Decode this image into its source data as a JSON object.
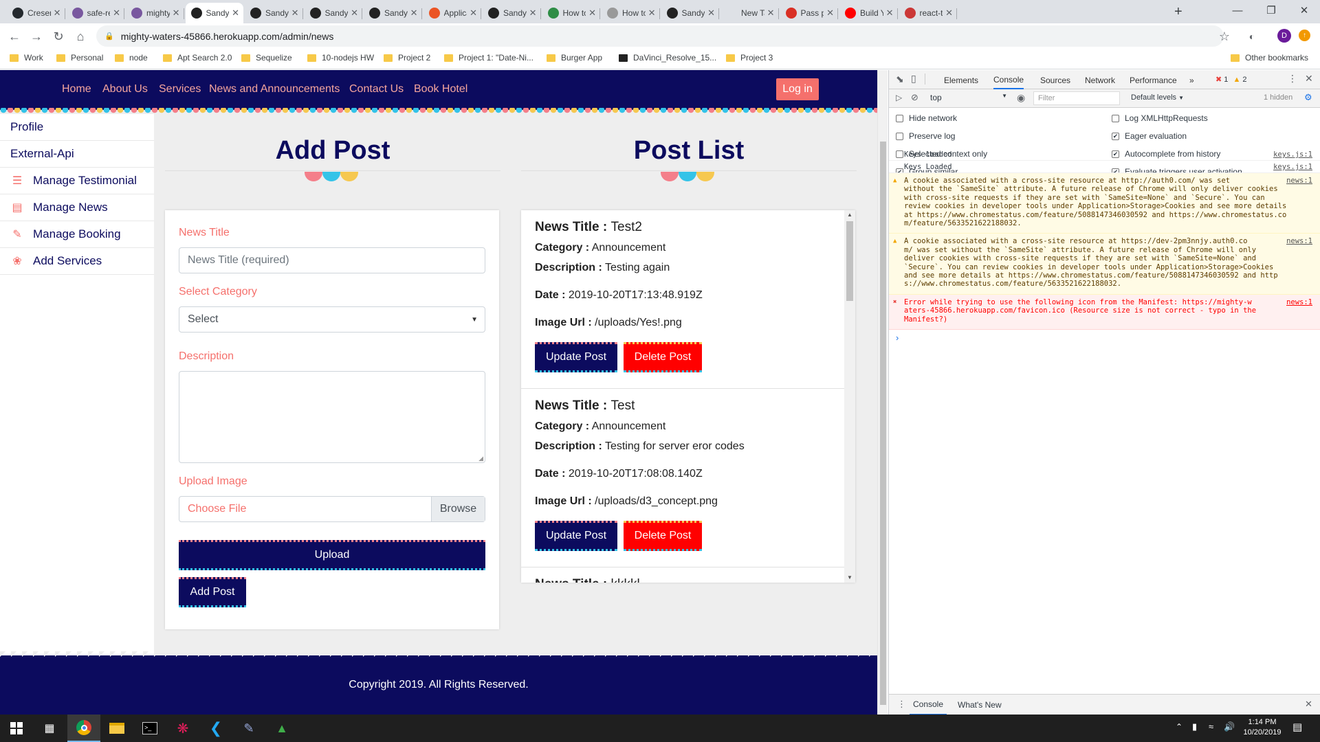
{
  "browser": {
    "tabs": [
      {
        "title": "Cresenc",
        "icon": "github-icon",
        "color": "#24292e"
      },
      {
        "title": "safe-ret",
        "icon": "heroku-icon",
        "color": "#79589f"
      },
      {
        "title": "mighty-",
        "icon": "heroku-icon",
        "color": "#79589f"
      },
      {
        "title": "Sandy's",
        "icon": "react-icon",
        "color": "#222"
      },
      {
        "title": "Sandy's",
        "icon": "react-icon",
        "color": "#222"
      },
      {
        "title": "Sandy's",
        "icon": "react-icon",
        "color": "#222"
      },
      {
        "title": "Sandy's",
        "icon": "react-icon",
        "color": "#222"
      },
      {
        "title": "Applica",
        "icon": "auth0-icon",
        "color": "#eb5424"
      },
      {
        "title": "Sandy's",
        "icon": "react-icon",
        "color": "#222"
      },
      {
        "title": "How to",
        "icon": "gfg-icon",
        "color": "#2f8d46"
      },
      {
        "title": "How to",
        "icon": "loading-icon",
        "color": "#999"
      },
      {
        "title": "Sandy's",
        "icon": "react-icon",
        "color": "#222"
      },
      {
        "title": "New Tab",
        "icon": "",
        "color": ""
      },
      {
        "title": "Pass pr",
        "icon": "chrome-red-icon",
        "color": "#d93025"
      },
      {
        "title": "Build Yo",
        "icon": "youtube-icon",
        "color": "#ff0000"
      },
      {
        "title": "react-to",
        "icon": "npm-icon",
        "color": "#cb3837"
      }
    ],
    "url": "mighty-waters-45866.herokuapp.com/admin/news",
    "bookmarks": [
      "Work",
      "Personal",
      "node",
      "Apt Search 2.0",
      "Sequelize",
      "10-nodejs HW",
      "Project 2",
      "Project 1: \"Date-Ni...",
      "Burger App",
      "DaVinci_Resolve_15...",
      "Project 3"
    ],
    "other_bookmarks": "Other bookmarks",
    "profile_initial": "D"
  },
  "site": {
    "nav": [
      "Home",
      "About Us",
      "Services",
      "News and Announcements",
      "Contact Us",
      "Book Hotel"
    ],
    "login": "Log in",
    "sidebar": [
      {
        "label": "Profile",
        "icon": ""
      },
      {
        "label": "External-Api",
        "icon": ""
      },
      {
        "label": "Manage Testimonial",
        "icon": "list-icon"
      },
      {
        "label": "Manage News",
        "icon": "newspaper-icon"
      },
      {
        "label": "Manage Booking",
        "icon": "pencil-icon"
      },
      {
        "label": "Add Services",
        "icon": "paw-icon"
      }
    ],
    "add_post": {
      "heading": "Add Post",
      "news_title_label": "News Title",
      "news_title_placeholder": "News Title (required)",
      "category_label": "Select Category",
      "category_value": "Select",
      "description_label": "Description",
      "upload_label": "Upload Image",
      "choose_file": "Choose File",
      "browse": "Browse",
      "upload_button": "Upload",
      "add_button": "Add Post"
    },
    "post_list": {
      "heading": "Post List",
      "posts": [
        {
          "title_label": "News Title :",
          "title": "Test2",
          "category_label": "Category :",
          "category": "Announcement",
          "description_label": "Description :",
          "description": "Testing again",
          "date_label": "Date :",
          "date": "2019-10-20T17:13:48.919Z",
          "image_label": "Image Url :",
          "image": "/uploads/Yes!.png"
        },
        {
          "title_label": "News Title :",
          "title": "Test",
          "category_label": "Category :",
          "category": "Announcement",
          "description_label": "Description :",
          "description": "Testing for server eror codes",
          "date_label": "Date :",
          "date": "2019-10-20T17:08:08.140Z",
          "image_label": "Image Url :",
          "image": "/uploads/d3_concept.png"
        },
        {
          "title_label": "News Title :",
          "title": "kkkkl"
        }
      ],
      "update_button": "Update Post",
      "delete_button": "Delete Post"
    },
    "footer": "Copyright 2019. All Rights Reserved."
  },
  "devtools": {
    "tabs": [
      "Elements",
      "Console",
      "Sources",
      "Network",
      "Performance"
    ],
    "more": "»",
    "error_count": "1",
    "warning_count": "2",
    "context": "top",
    "filter_placeholder": "Filter",
    "levels": "Default levels",
    "hidden": "1 hidden",
    "settings_left": [
      {
        "label": "Hide network",
        "checked": false
      },
      {
        "label": "Preserve log",
        "checked": false
      },
      {
        "label": "Selected context only",
        "checked": false
      },
      {
        "label": "Group similar",
        "checked": true
      }
    ],
    "settings_right": [
      {
        "label": "Log XMLHttpRequests",
        "checked": false
      },
      {
        "label": "Eager evaluation",
        "checked": true
      },
      {
        "label": "Autocomplete from history",
        "checked": true
      },
      {
        "label": "Evaluate triggers user activation",
        "checked": true
      }
    ],
    "logs": [
      {
        "msg": "Keys loaded",
        "src": "keys.js:1"
      },
      {
        "msg": "Keys Loaded",
        "src": "keys.js:1"
      }
    ],
    "warnings": [
      {
        "lines": [
          "A cookie associated with a cross-site resource at http://auth0.com/ was set",
          "without the `SameSite` attribute. A future release of Chrome will only deliver cookies",
          "with cross-site requests if they are set with `SameSite=None` and `Secure`. You can",
          "review cookies in developer tools under Application>Storage>Cookies and see more details",
          "at https://www.chromestatus.com/feature/5088147346030592 and https://www.chromestatus.co",
          "m/feature/5633521622188032."
        ],
        "src": "news:1"
      },
      {
        "lines": [
          "A cookie associated with a cross-site resource at https://dev-2pm3nnjy.auth0.co",
          "m/ was set without the `SameSite` attribute. A future release of Chrome will only",
          "deliver cookies with cross-site requests if they are set with `SameSite=None` and",
          "`Secure`. You can review cookies in developer tools under Application>Storage>Cookies",
          "and see more details at https://www.chromestatus.com/feature/5088147346030592 and http",
          "s://www.chromestatus.com/feature/5633521622188032."
        ],
        "src": "news:1"
      }
    ],
    "error": {
      "lines": [
        "Error while trying to use the following icon from the Manifest: https://mighty-w",
        "aters-45866.herokuapp.com/favicon.ico (Resource size is not correct - typo in the",
        "Manifest?)"
      ],
      "src": "news:1"
    },
    "prompt": "›",
    "drawer_tabs": [
      "Console",
      "What's New"
    ]
  },
  "taskbar": {
    "time": "1:14 PM",
    "date": "10/20/2019"
  }
}
